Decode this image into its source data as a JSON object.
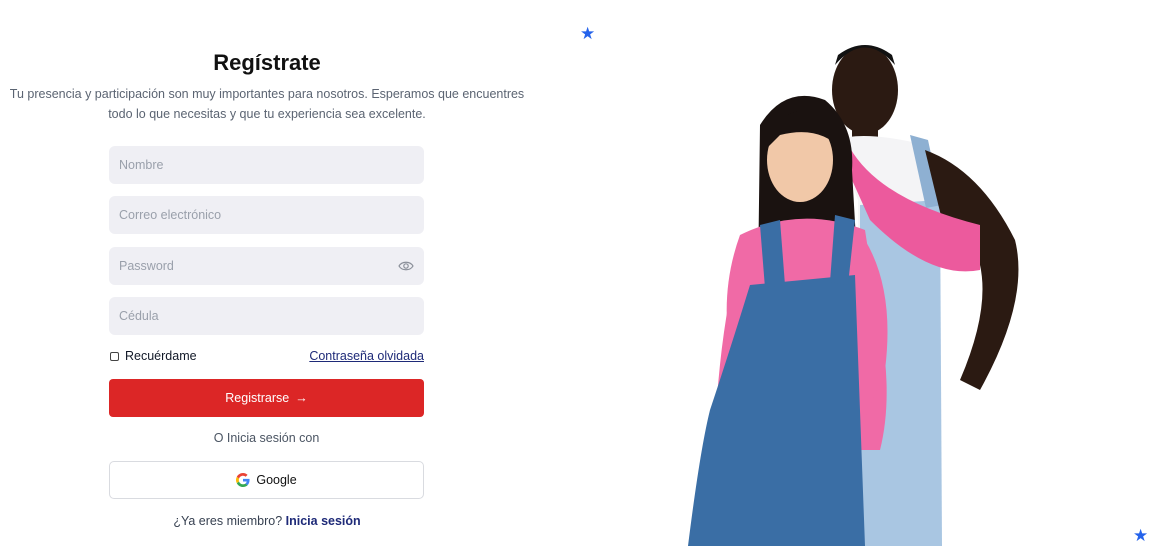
{
  "header": {
    "title": "Regístrate",
    "subtitle_line1": "Tu presencia y participación son muy importantes para nosotros. Esperamos que encuentres",
    "subtitle_line2": "todo lo que necesitas y que tu experiencia sea excelente."
  },
  "form": {
    "name_placeholder": "Nombre",
    "email_placeholder": "Correo electrónico",
    "password_placeholder": "Password",
    "id_placeholder": "Cédula",
    "remember_label": "Recuérdame",
    "forgot_link": "Contraseña olvidada",
    "submit_label": "Registrarse",
    "submit_arrow": "→",
    "or_text": "O Inicia sesión con",
    "google_label": "Google",
    "member_text": "¿Ya eres miembro?",
    "login_link": "Inicia sesión"
  },
  "icons": {
    "star": "★",
    "eye": "eye-icon",
    "google": "google-logo-icon"
  },
  "colors": {
    "accent": "#dc2626",
    "link": "#1e2a78",
    "star": "#2563eb",
    "input_bg": "#efeff4"
  }
}
